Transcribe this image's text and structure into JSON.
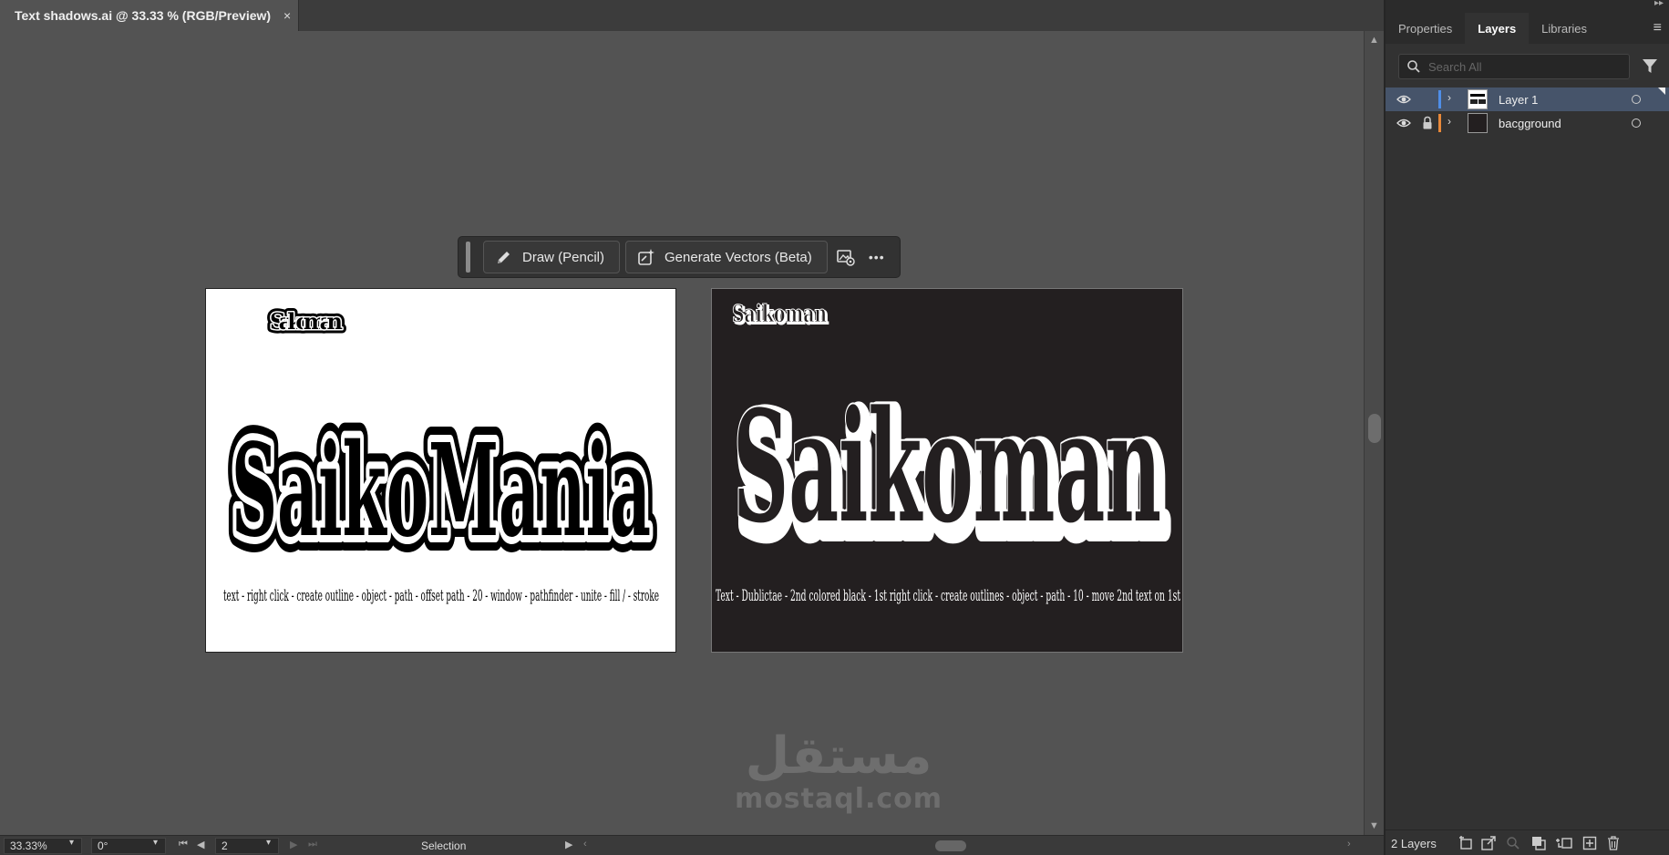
{
  "document": {
    "tab_title": "Text shadows.ai @ 33.33 % (RGB/Preview)",
    "close_glyph": "×"
  },
  "taskbar": {
    "draw_label": "Draw (Pencil)",
    "generate_label": "Generate Vectors (Beta)",
    "more_glyph": "•••"
  },
  "artboard1": {
    "small_text": "Saikoman",
    "big_text": "SaikoMania",
    "caption": "text - right click - create outline - object - path - offset path - 20 - window - pathfinder - unite - fill / - stroke",
    "background": "#ffffff"
  },
  "artboard2": {
    "small_text": "Saikoman",
    "big_text": "Saikoman",
    "caption": "Text - Dublictae - 2nd colored black - 1st  right click - create outlines - object - path - 10  - move 2nd text on 1st",
    "background": "#231f20"
  },
  "watermark": {
    "arabic": "مستقل",
    "latin": "mostaql.com"
  },
  "statusbar": {
    "zoom": "33.33%",
    "rotation": "0°",
    "artboard_number": "2",
    "tool": "Selection"
  },
  "panel": {
    "tabs": [
      {
        "label": "Properties",
        "active": false
      },
      {
        "label": "Layers",
        "active": true
      },
      {
        "label": "Libraries",
        "active": false
      }
    ],
    "search_placeholder": "Search All",
    "layers": [
      {
        "name": "Layer 1",
        "color": "#4f8ee8",
        "locked": false,
        "selected": true
      },
      {
        "name": "bacgground",
        "color": "#e8883a",
        "locked": true,
        "selected": false
      }
    ],
    "layer_count": "2 Layers"
  },
  "icons": {
    "eye": "eye-icon",
    "lock": "lock-icon",
    "chevron": "chevron-right-icon",
    "search": "search-icon",
    "filter": "filter-icon",
    "pencil": "pencil-icon",
    "generate": "generate-vectors-icon",
    "image-settings": "image-settings-icon",
    "panel-menu": "hamburger-menu-icon"
  }
}
